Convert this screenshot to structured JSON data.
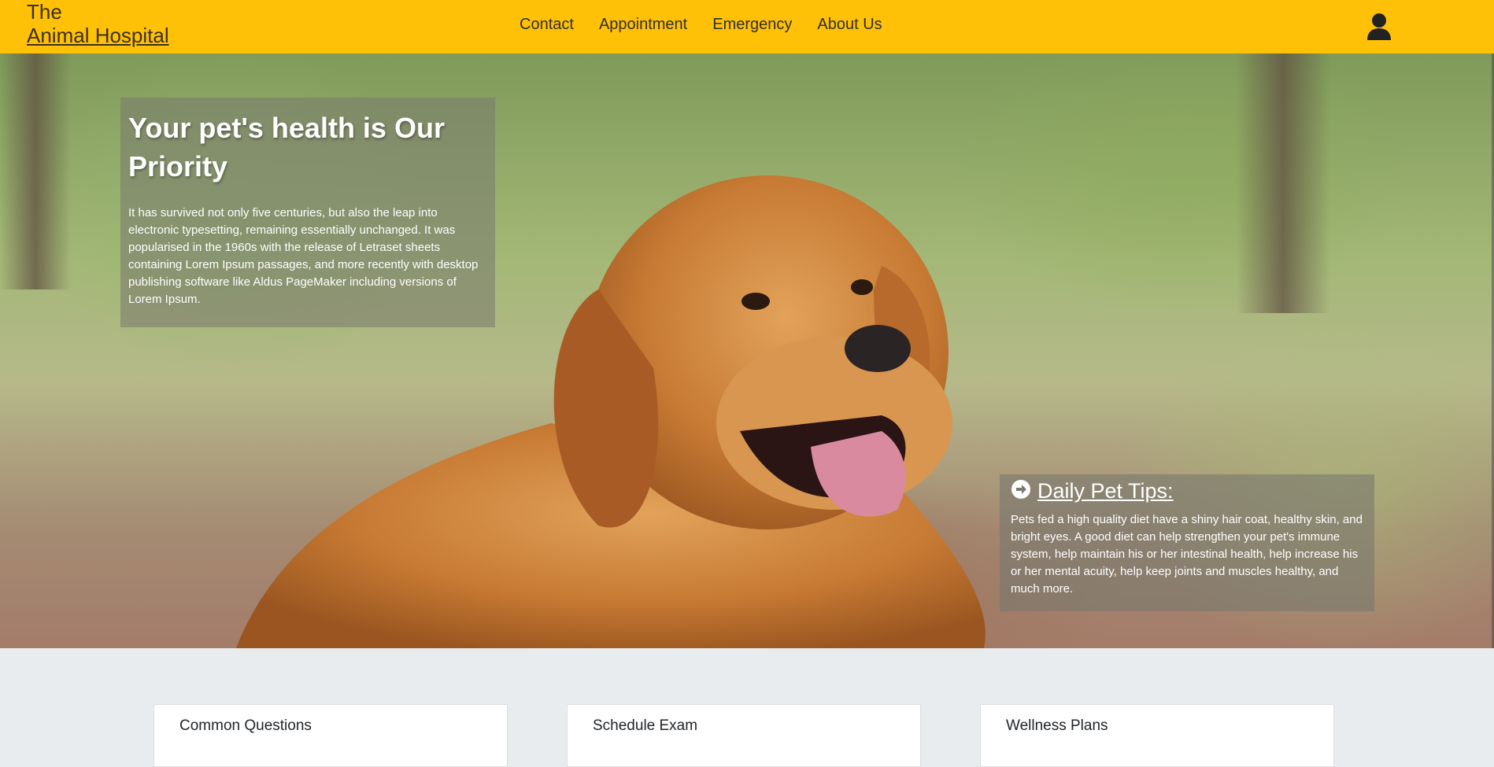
{
  "brand": {
    "line1": "The",
    "line2": "Animal Hospital"
  },
  "nav": {
    "items": [
      "Contact",
      "Appointment",
      "Emergency",
      "About Us"
    ]
  },
  "account_icon": "user-icon",
  "hero": {
    "intro_title": "Your pet's health is Our Priority",
    "intro_text": "It has survived not only five centuries, but also the leap into electronic typesetting, remaining essentially unchanged. It was popularised in the 1960s with the release of Letraset sheets containing Lorem Ipsum passages, and more recently with desktop publishing software like Aldus PageMaker including versions of Lorem Ipsum.",
    "tips_icon": "arrow-circle-right-icon",
    "tips_title": "Daily Pet Tips:",
    "tips_text": "Pets fed a high quality diet have a shiny hair coat, healthy skin, and bright eyes. A good diet can help strengthen your pet's immune system, help maintain his or her intestinal health, help increase his or her mental acuity, help keep joints and muscles healthy, and much more."
  },
  "cards": [
    {
      "title": "Common Questions"
    },
    {
      "title": "Schedule Exam"
    },
    {
      "title": "Wellness Plans"
    }
  ],
  "colors": {
    "header": "#ffc107",
    "section_bg": "#e9ecef"
  }
}
